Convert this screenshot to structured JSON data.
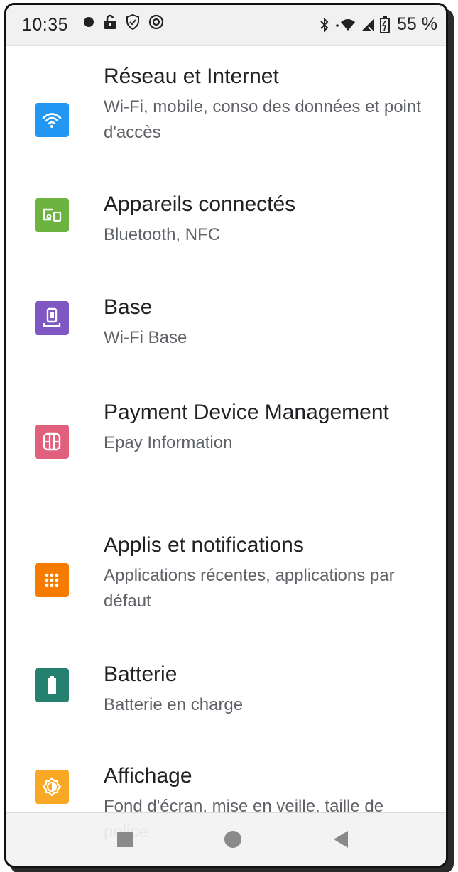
{
  "status_bar": {
    "time": "10:35",
    "battery_percent": "55 %",
    "left_icons": [
      "dot-icon",
      "lock-icon",
      "shield-icon",
      "at-icon"
    ],
    "right_icons": [
      "bluetooth-icon",
      "wifi-icon",
      "signal-icon",
      "battery-icon"
    ]
  },
  "settings": [
    {
      "title": "Réseau et Internet",
      "subtitle": "Wi-Fi, mobile, conso des données et point d'accès",
      "icon": "wifi-icon",
      "color": "#2196F3"
    },
    {
      "title": "Appareils connectés",
      "subtitle": "Bluetooth, NFC",
      "icon": "devices-icon",
      "color": "#6DB33F"
    },
    {
      "title": "Base",
      "subtitle": "Wi-Fi Base",
      "icon": "base-device-icon",
      "color": "#7E57C2"
    },
    {
      "title": "Payment Device Management",
      "subtitle": "Epay Information",
      "icon": "card-icon",
      "color": "#E0607E"
    },
    {
      "title": "Applis et notifications",
      "subtitle": "Applications récentes, applications par défaut",
      "icon": "apps-grid-icon",
      "color": "#F57C00"
    },
    {
      "title": "Batterie",
      "subtitle": "Batterie en charge",
      "icon": "battery-icon",
      "color": "#26806F"
    },
    {
      "title": "Affichage",
      "subtitle": "Fond d'écran, mise en veille, taille de police",
      "icon": "brightness-icon",
      "color": "#F9A825"
    }
  ],
  "nav_bar": {
    "buttons": [
      "recents-button",
      "home-button",
      "back-button"
    ]
  }
}
